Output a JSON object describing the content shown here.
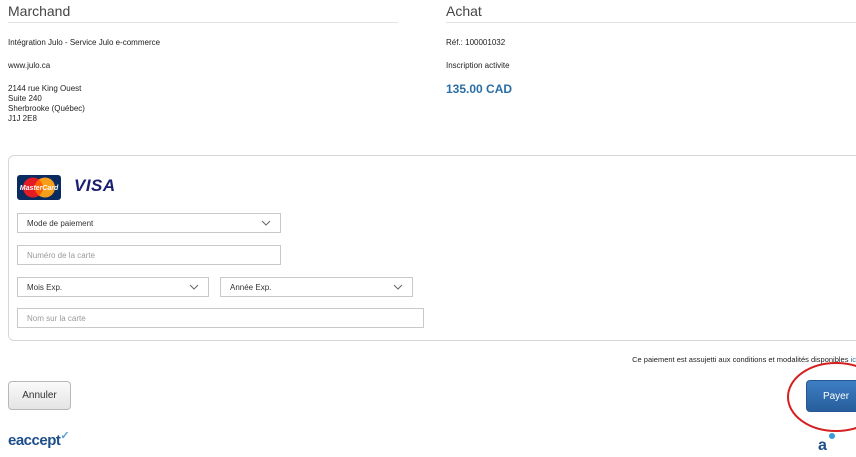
{
  "merchant": {
    "heading": "Marchand",
    "name": "Intégration Julo - Service Julo e-commerce",
    "website": "www.julo.ca",
    "address": "2144 rue King Ouest\nSuite 240\nSherbrooke (Québec)\nJ1J 2E8"
  },
  "purchase": {
    "heading": "Achat",
    "reference": "Réf.: 100001032",
    "description": "Inscription activite",
    "amount": "135.00 CAD"
  },
  "card_form": {
    "brands": [
      "MasterCard",
      "VISA"
    ],
    "payment_mode": "Mode de paiement",
    "card_number_placeholder": "Numéro de la carte",
    "exp_month": "Mois Exp.",
    "exp_year": "Année Exp.",
    "name_placeholder": "Nom sur la carte"
  },
  "terms": {
    "text": "Ce paiement est assujetti aux conditions et modalités disponibles ",
    "link": "ic"
  },
  "actions": {
    "cancel": "Annuler",
    "pay": "Payer"
  },
  "footer": {
    "logo": "eaccept",
    "partner_logo_text": "a"
  },
  "colors": {
    "accent": "#2a6ea6",
    "pay_button": "#2f6cae",
    "highlight_circle": "#d42020"
  }
}
